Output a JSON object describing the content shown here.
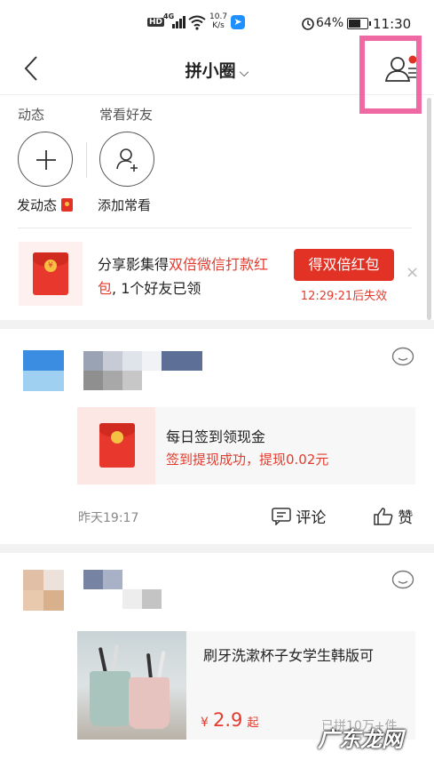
{
  "status_bar": {
    "hd": "HD",
    "network": "4G",
    "speed_value": "10.7",
    "speed_unit": "K/s",
    "battery_pct": "64%",
    "battery_level": 0.64,
    "time": "11:30"
  },
  "nav": {
    "title": "拼小圈",
    "title_chevron": "⌵"
  },
  "sections": {
    "moments_label": "动态",
    "friends_label": "常看好友",
    "post_caption": "发动态",
    "add_caption": "添加常看"
  },
  "promo": {
    "coin": "¥",
    "text_a": "分享影集得",
    "text_red": "双倍微信打款红包",
    "text_b": ", 1个好友已领",
    "button": "得双倍红包",
    "countdown": "12:29:21后失效",
    "close": "×"
  },
  "feed": [
    {
      "card_title": "每日签到领现金",
      "card_sub": "签到提现成功，提现0.02元",
      "time": "昨天19:17",
      "comment_label": "评论",
      "like_label": "赞"
    },
    {
      "card_title": "刷牙洗漱杯子女学生韩版可",
      "price_symbol": "¥",
      "price": "2.9",
      "price_suffix": "起",
      "sold": "已拼10万+件"
    }
  ],
  "watermark": "广东龙网",
  "colors": {
    "accent_red": "#e23225",
    "highlight_pink": "#ef6aa2"
  }
}
